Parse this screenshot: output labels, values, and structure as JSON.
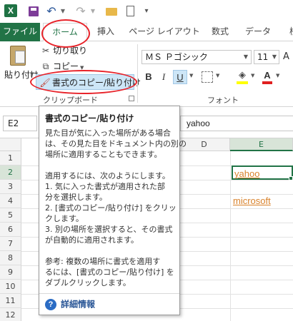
{
  "tabs": {
    "file": "ファイル",
    "home": "ホーム",
    "insert": "挿入",
    "page_layout": "ページ レイアウト",
    "formulas": "数式",
    "data": "データ",
    "review": "校"
  },
  "qat": {
    "app_icon": "X",
    "icons": [
      "excel-icon",
      "save-icon",
      "undo-icon",
      "redo-icon",
      "folder-icon",
      "new-document-icon"
    ]
  },
  "clipboard": {
    "paste": "貼り付け",
    "cut": "切り取り",
    "copy": "コピー",
    "format_painter": "書式のコピー/貼り付け",
    "group_label": "クリップボード"
  },
  "font": {
    "font_name": "ＭＳ Ｐゴシック",
    "font_size": "11",
    "group_label": "フォント",
    "bold": "B",
    "italic": "I",
    "underline": "U",
    "font_color": "A",
    "fill_color_hex": "#ffff00",
    "font_color_hex": "#e02020"
  },
  "formula_bar": {
    "name_box": "E2",
    "value": "yahoo"
  },
  "grid": {
    "columns": [
      "D",
      "E"
    ],
    "rows": [
      "1",
      "2",
      "3",
      "4",
      "5",
      "6",
      "7",
      "8",
      "9",
      "10",
      "11",
      "12"
    ],
    "cells": {
      "E2": "yahoo",
      "E4": "microsoft"
    },
    "link_color": "#d9822b",
    "accent": "#217346"
  },
  "tooltip": {
    "title": "書式のコピー/貼り付け",
    "para1": [
      "見た目が気に入った場所がある場合",
      "は、その見た目をドキュメント内の別の",
      "場所に適用することもできます。"
    ],
    "para2": [
      "適用するには、次のようにします。",
      "1. 気に入った書式が適用された部",
      "分を選択します。",
      "2. [書式のコピー/貼り付け] をクリッ",
      "クします。",
      "3. 別の場所を選択すると、その書式",
      "が自動的に適用されます。"
    ],
    "para3": [
      "参考: 複数の場所に書式を適用す",
      "るには、[書式のコピー/貼り付け] を",
      "ダブルクリックします。"
    ],
    "help_link": "詳細情報"
  }
}
